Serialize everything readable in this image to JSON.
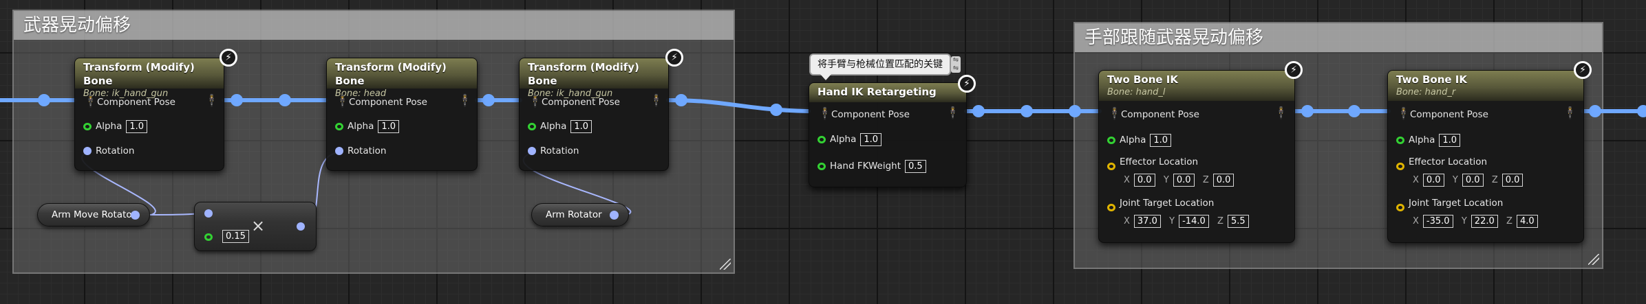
{
  "comments": [
    {
      "title": "武器晃动偏移"
    },
    {
      "title": "手部跟随武器晃动偏移"
    }
  ],
  "icons": {
    "pose": "mannequin-icon",
    "bolt": "lightning-icon"
  },
  "colors": {
    "exec_wire": "#6fa8ff",
    "float_pin": "#33d133",
    "vector_pin": "#e0b400",
    "rotator_pin": "#9fb3ff",
    "header": "#6a6a44"
  },
  "nodes": {
    "tmb1": {
      "title": "Transform (Modify) Bone",
      "subtitle": "Bone: ik_hand_gun",
      "pose": "Component Pose",
      "alpha_label": "Alpha",
      "alpha": "1.0",
      "rotation": "Rotation"
    },
    "tmb2": {
      "title": "Transform (Modify) Bone",
      "subtitle": "Bone: head",
      "pose": "Component Pose",
      "alpha_label": "Alpha",
      "alpha": "1.0",
      "rotation": "Rotation"
    },
    "tmb3": {
      "title": "Transform (Modify) Bone",
      "subtitle": "Bone: ik_hand_gun",
      "pose": "Component Pose",
      "alpha_label": "Alpha",
      "alpha": "1.0",
      "rotation": "Rotation"
    },
    "hand_ik": {
      "title": "Hand IK Retargeting",
      "pose": "Component Pose",
      "alpha_label": "Alpha",
      "alpha": "1.0",
      "fk_label": "Hand FKWeight",
      "fk": "0.5",
      "tooltip": "将手臂与枪械位置匹配的关键"
    },
    "tbik1": {
      "title": "Two Bone IK",
      "subtitle": "Bone: hand_l",
      "pose": "Component Pose",
      "alpha_label": "Alpha",
      "alpha": "1.0",
      "effector_label": "Effector Location",
      "effector": [
        "0.0",
        "0.0",
        "0.0"
      ],
      "joint_label": "Joint Target Location",
      "joint": [
        "37.0",
        "-14.0",
        "5.5"
      ]
    },
    "tbik2": {
      "title": "Two Bone IK",
      "subtitle": "Bone: hand_r",
      "pose": "Component Pose",
      "alpha_label": "Alpha",
      "alpha": "1.0",
      "effector_label": "Effector Location",
      "effector": [
        "0.0",
        "0.0",
        "0.0"
      ],
      "joint_label": "Joint Target Location",
      "joint": [
        "-35.0",
        "22.0",
        "4.0"
      ]
    }
  },
  "axes": [
    "X",
    "Y",
    "Z"
  ],
  "vars": {
    "arm_move_rotator": "Arm Move Rotator",
    "arm_rotator": "Arm Rotator"
  },
  "multiply": {
    "symbol": "×",
    "value": "0.15"
  }
}
